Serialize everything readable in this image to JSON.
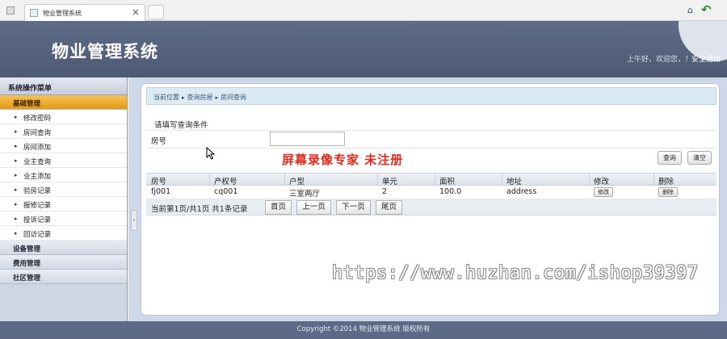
{
  "browser": {
    "tab_title": "物业管理系统",
    "tab_close": "×",
    "home_icon": "home-icon",
    "back_icon": "back-arrow-icon"
  },
  "header": {
    "title": "物业管理系统",
    "greeting": "上午好，欢迎您，！",
    "logout": "安全退出"
  },
  "sidebar": {
    "title": "系统操作菜单",
    "groups": [
      {
        "label": "基础管理",
        "active": true,
        "items": [
          "修改密码",
          "房间查询",
          "房间添加",
          "业主查询",
          "业主添加",
          "验房记录",
          "报修记录",
          "投诉记录",
          "回访记录"
        ]
      },
      {
        "label": "设备管理",
        "active": false
      },
      {
        "label": "费用管理",
        "active": false
      },
      {
        "label": "社区管理",
        "active": false
      }
    ],
    "collapse_icon": "‹"
  },
  "breadcrumb": {
    "items": [
      "当前位置",
      "查询房屋",
      "房间查询"
    ],
    "separator_icon": "▸"
  },
  "query": {
    "title": "请填写查询条件",
    "room_label": "房号",
    "room_value": "",
    "query_button": "查询",
    "clear_button": "清空"
  },
  "table": {
    "headers": [
      "房号",
      "产权号",
      "户型",
      "单元",
      "面积",
      "地址",
      "修改",
      "删除"
    ],
    "rows": [
      {
        "room": "fj001",
        "property_no": "cq001",
        "layout": "三室两厅",
        "unit": "2",
        "area": "100.0",
        "address": "address",
        "edit": "修改",
        "delete": "删除"
      }
    ]
  },
  "pager": {
    "info": "当前第1页/共1页  共1条记录",
    "first": "首页",
    "prev": "上一页",
    "next": "下一页",
    "last": "尾页"
  },
  "watermarks": {
    "recorder": "屏幕录像专家  未注册",
    "url": "https://www.huzhan.com/ishop39397"
  },
  "footer": {
    "text": "Copyright ©2014 物业管理系统 版权所有"
  },
  "colors": {
    "header_bg": "#56627d",
    "active_group": "#eea32a",
    "breadcrumb_bg": "#dbeaf3",
    "watermark_red": "#e1281c"
  }
}
